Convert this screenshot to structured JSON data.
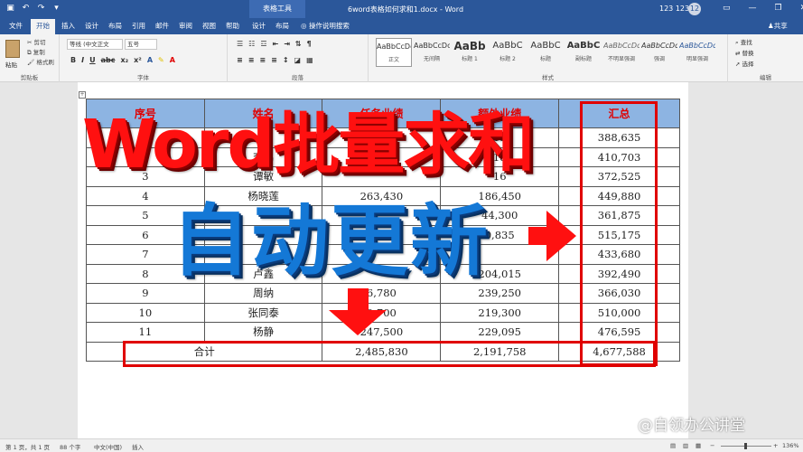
{
  "titlebar": {
    "context_tools": "表格工具",
    "doc_title": "6word表格如何求和1.docx - Word",
    "user": "123 123",
    "avatar_initials": "12"
  },
  "tabs": [
    "文件",
    "开始",
    "插入",
    "设计",
    "布局",
    "引用",
    "邮件",
    "审阅",
    "视图",
    "帮助",
    "设计",
    "布局"
  ],
  "active_tab": "开始",
  "tell_me": "操作说明搜索",
  "share": "共享",
  "ribbon": {
    "clipboard": {
      "paste": "粘贴",
      "cut": "剪切",
      "copy": "复制",
      "painter": "格式刷",
      "label": "剪贴板"
    },
    "font": {
      "font_name": "等线 (中文正文",
      "font_size": "五号",
      "label": "字体"
    },
    "paragraph_label": "段落",
    "styles": {
      "items": [
        {
          "sample": "AaBbCcDc",
          "name": "正文"
        },
        {
          "sample": "AaBbCcDc",
          "name": "无间隔"
        },
        {
          "sample": "AaBb",
          "name": "标题 1"
        },
        {
          "sample": "AaBbC",
          "name": "标题 2"
        },
        {
          "sample": "AaBbC",
          "name": "标题"
        },
        {
          "sample": "AaBbC",
          "name": "副标题"
        },
        {
          "sample": "AaBbCcDc",
          "name": "不明显强调"
        },
        {
          "sample": "AaBbCcDc",
          "name": "强调"
        },
        {
          "sample": "AaBbCcDc",
          "name": "明显强调"
        }
      ],
      "label": "样式"
    },
    "editing": {
      "find": "查找",
      "replace": "替换",
      "select": "选择",
      "label": "编辑"
    }
  },
  "table": {
    "headers": [
      "序号",
      "姓名",
      "任务业绩",
      "额外业绩",
      "汇总"
    ],
    "rows": [
      [
        "1",
        "李",
        "25",
        "15",
        "388,635"
      ],
      [
        "2",
        "李鹏",
        "1",
        "18",
        "410,703"
      ],
      [
        "3",
        "谭敏",
        "",
        "16",
        "372,525"
      ],
      [
        "4",
        "杨晓莲",
        "263,430",
        "186,450",
        "449,880"
      ],
      [
        "5",
        "",
        "",
        "44,300",
        "361,875"
      ],
      [
        "6",
        "",
        "",
        "0,835",
        "515,175"
      ],
      [
        "7",
        "",
        "",
        "",
        "433,680"
      ],
      [
        "8",
        "卢鑫",
        "",
        "204,015",
        "392,490"
      ],
      [
        "9",
        "周纳",
        "6,780",
        "239,250",
        "366,030"
      ],
      [
        "10",
        "张同泰",
        "0,700",
        "219,300",
        "510,000"
      ],
      [
        "11",
        "杨静",
        "247,500",
        "229,095",
        "476,595"
      ]
    ],
    "total_row": [
      "合计",
      "2,485,830",
      "2,191,758",
      "4,677,588"
    ]
  },
  "overlay": {
    "line1": "Word批量求和",
    "line2": "自动更新"
  },
  "colors": {
    "accent": "#2b579a",
    "header_fill": "#8db4e2",
    "highlight_red": "#e00000",
    "overlay_blue": "#1478d6"
  },
  "statusbar": {
    "page": "第 1 页，共 1 页",
    "words": "88 个字",
    "lang": "中文(中国)",
    "mode": "插入",
    "zoom": "136%"
  },
  "watermark": "@自领办公讲堂"
}
